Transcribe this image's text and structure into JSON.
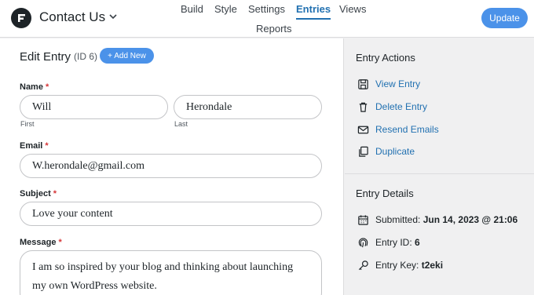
{
  "header": {
    "form_title": "Contact Us",
    "nav": [
      {
        "label": "Build"
      },
      {
        "label": "Style"
      },
      {
        "label": "Settings"
      },
      {
        "label": "Entries",
        "active": true
      },
      {
        "label": "Views"
      },
      {
        "label": "Reports"
      }
    ],
    "update_label": "Update"
  },
  "main": {
    "title": "Edit Entry",
    "entry_id_label": "(ID 6)",
    "add_new_label": "+ Add New",
    "fields": {
      "name": {
        "label": "Name",
        "required_mark": "*",
        "first_value": "Will",
        "first_sublabel": "First",
        "last_value": "Herondale",
        "last_sublabel": "Last"
      },
      "email": {
        "label": "Email",
        "required_mark": "*",
        "value": "W.herondale@gmail.com"
      },
      "subject": {
        "label": "Subject",
        "required_mark": "*",
        "value": "Love your content"
      },
      "message": {
        "label": "Message",
        "required_mark": "*",
        "value": "I am so inspired by your blog and thinking about launching my own WordPress website."
      }
    }
  },
  "sidebar": {
    "actions_title": "Entry Actions",
    "actions": [
      {
        "label": "View Entry",
        "icon": "save-icon"
      },
      {
        "label": "Delete Entry",
        "icon": "trash-icon"
      },
      {
        "label": "Resend Emails",
        "icon": "envelope-icon"
      },
      {
        "label": "Duplicate",
        "icon": "duplicate-icon"
      }
    ],
    "details_title": "Entry Details",
    "details": {
      "submitted_label": "Submitted:",
      "submitted_value": "Jun 14, 2023 @ 21:06",
      "entry_id_label": "Entry ID:",
      "entry_id_value": "6",
      "entry_key_label": "Entry Key:",
      "entry_key_value": "t2eki"
    }
  },
  "colors": {
    "accent": "#4b92e9",
    "link": "#2271b1",
    "required": "#d63638"
  }
}
